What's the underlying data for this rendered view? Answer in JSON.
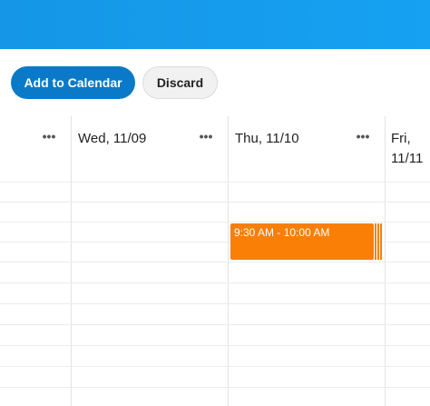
{
  "actions": {
    "add_label": "Add to Calendar",
    "discard_label": "Discard"
  },
  "days": [
    {
      "label": "",
      "more": "•••"
    },
    {
      "label": "Wed, 11/09",
      "more": "•••"
    },
    {
      "label": "Thu, 11/10",
      "more": "•••"
    },
    {
      "label": "Fri, 11/11"
    }
  ],
  "event": {
    "time": "9:30 AM - 10:00 AM",
    "color": "#f97f06"
  },
  "colors": {
    "topbar": "#1596e6",
    "primary_button": "#0a7ac8"
  }
}
